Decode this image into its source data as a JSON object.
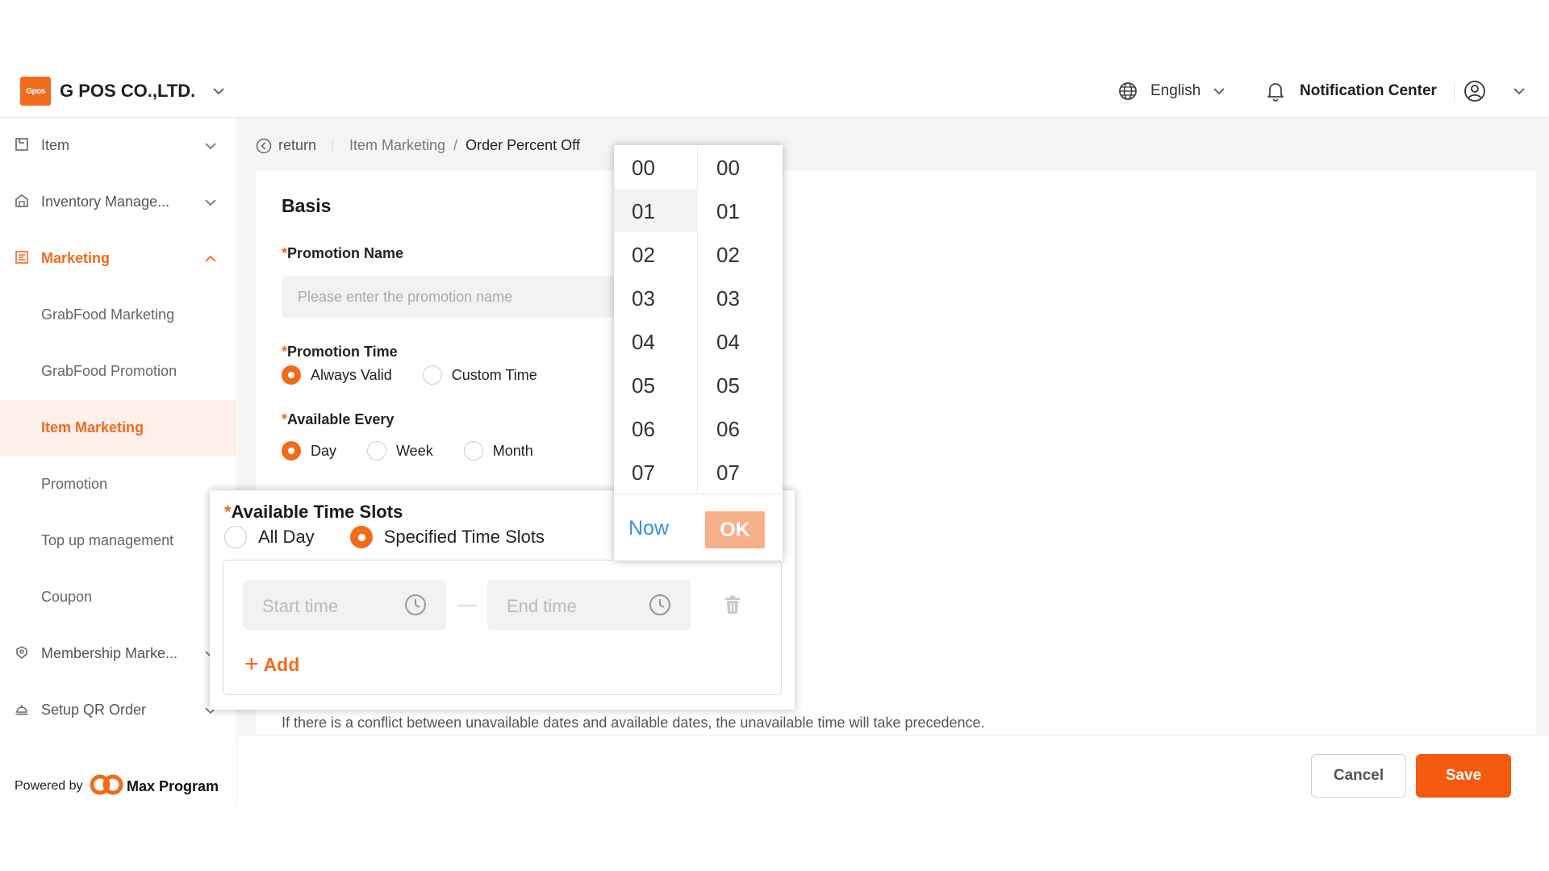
{
  "header": {
    "logo_text": "Gpos",
    "company_name": "G POS CO.,LTD.",
    "language": "English",
    "notification_label": "Notification Center"
  },
  "sidebar": {
    "items": [
      {
        "label": "Item"
      },
      {
        "label": "Inventory Manage..."
      },
      {
        "label": "Marketing"
      },
      {
        "label": "GrabFood Marketing"
      },
      {
        "label": "GrabFood Promotion"
      },
      {
        "label": "Item Marketing"
      },
      {
        "label": "Promotion"
      },
      {
        "label": "Top up management"
      },
      {
        "label": "Coupon"
      },
      {
        "label": "Membership Marke..."
      },
      {
        "label": "Setup QR Order"
      }
    ],
    "powered_by": "Powered by",
    "brand": "Max Program"
  },
  "breadcrumb": {
    "return_label": "return",
    "parent": "Item Marketing",
    "separator": "/",
    "current": "Order Percent Off"
  },
  "form": {
    "section_title": "Basis",
    "required_mark": "*",
    "promotion_name": {
      "label": "Promotion Name",
      "placeholder": "Please enter the promotion name"
    },
    "promotion_time": {
      "label": "Promotion Time",
      "options": [
        "Always Valid",
        "Custom Time"
      ],
      "selected": "Always Valid"
    },
    "available_every": {
      "label": "Available Every",
      "options": [
        "Day",
        "Week",
        "Month"
      ],
      "selected": "Day"
    },
    "time_slots": {
      "label": "Available Time Slots",
      "options": [
        "All Day",
        "Specified Time Slots"
      ],
      "selected": "Specified Time Slots",
      "start_placeholder": "Start time",
      "end_placeholder": "End time",
      "add_label": "Add"
    },
    "conflict_note": "If there is a conflict between unavailable dates and available dates, the unavailable time will take precedence."
  },
  "time_picker": {
    "hours": [
      "00",
      "01",
      "02",
      "03",
      "04",
      "05",
      "06",
      "07"
    ],
    "minutes": [
      "00",
      "01",
      "02",
      "03",
      "04",
      "05",
      "06",
      "07"
    ],
    "selected_hour": "01",
    "now_label": "Now",
    "ok_label": "OK"
  },
  "actions": {
    "cancel_label": "Cancel",
    "save_label": "Save"
  },
  "colors": {
    "accent": "#f26b1d",
    "save": "#f55a0f",
    "ok_disabled": "#f8b08b",
    "link_blue": "#3a8ee6"
  }
}
